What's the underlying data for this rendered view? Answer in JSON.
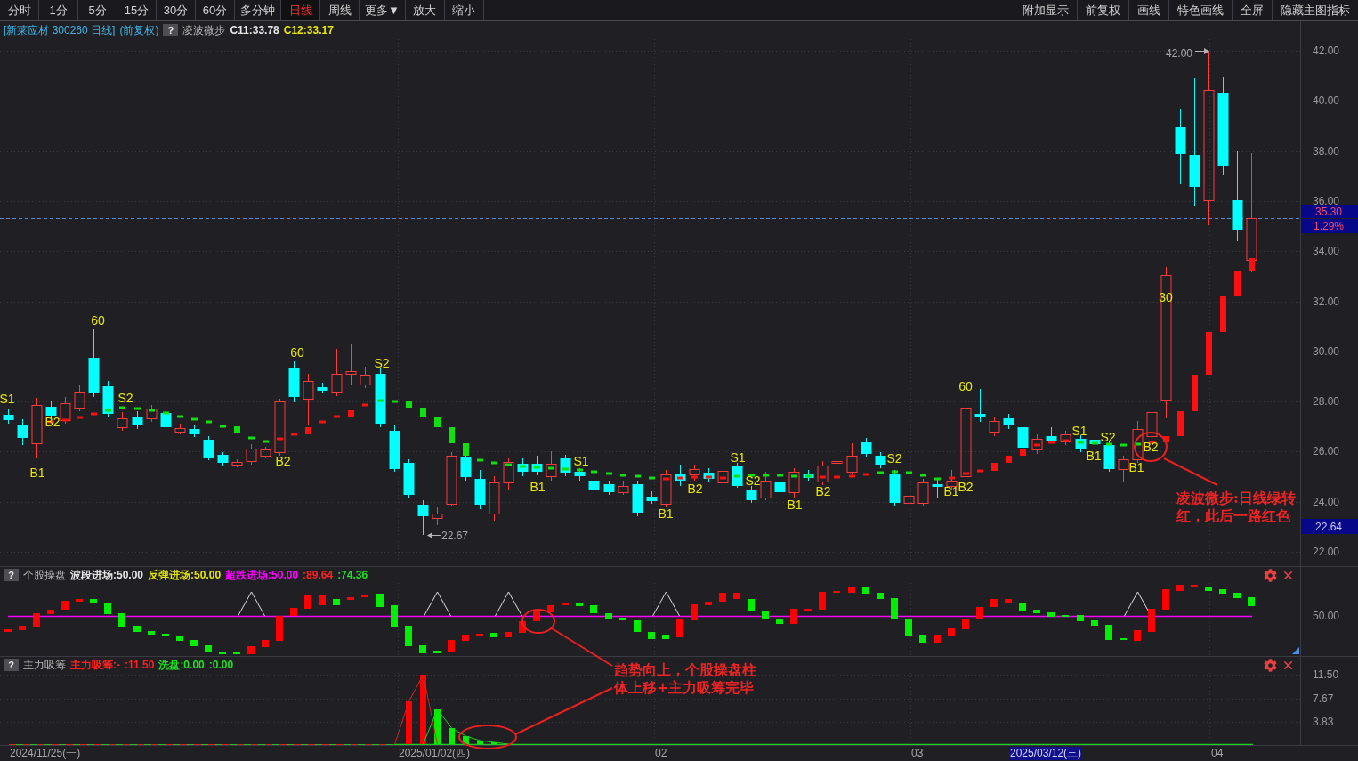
{
  "toolbar": {
    "periods": [
      {
        "label": "分时",
        "selected": false
      },
      {
        "label": "1分",
        "selected": false
      },
      {
        "label": "5分",
        "selected": false
      },
      {
        "label": "15分",
        "selected": false
      },
      {
        "label": "30分",
        "selected": false
      },
      {
        "label": "60分",
        "selected": false
      },
      {
        "label": "多分钟",
        "selected": false
      },
      {
        "label": "日线",
        "selected": true
      },
      {
        "label": "周线",
        "selected": false
      },
      {
        "label": "更多▼",
        "selected": false
      }
    ],
    "zoom": [
      "放大",
      "缩小"
    ],
    "actions": [
      "附加显示",
      "前复权",
      "画线",
      "特色画线",
      "全屏",
      "隐藏主图指标"
    ]
  },
  "main_chart": {
    "title": "[新莱应材 300260 日线]",
    "adjustment": "(前复权)",
    "help": "?",
    "indicator": "凌波微步",
    "readings": [
      {
        "text": "C11:33.78",
        "color": "#e6e6e6"
      },
      {
        "text": "C12:33.17",
        "color": "#e6e600"
      }
    ],
    "high_label": "42.00",
    "low_label": "22.67",
    "signals": [
      "S1",
      "B1",
      "B2",
      "60",
      "S2",
      "B2",
      "60",
      "S2",
      "B1",
      "S1",
      "B1",
      "B2",
      "S1",
      "S2",
      "B1",
      "B2",
      "S2",
      "B1",
      "60",
      "B2",
      "S1",
      "B1",
      "S2",
      "B1",
      "B2",
      "30"
    ],
    "y_ticks": [
      "42.00",
      "40.00",
      "38.00",
      "36.00",
      "34.00",
      "32.00",
      "30.00",
      "28.00",
      "26.00",
      "24.00",
      "22.00"
    ],
    "last_price": "35.30",
    "change": "1.29%",
    "low_tag": "22.64"
  },
  "panel_2": {
    "help": "?",
    "name": "个股操盘",
    "readings": [
      {
        "text": "波段进场:50.00",
        "color": "#e6e6e6"
      },
      {
        "text": "反弹进场:50.00",
        "color": "#e6e600"
      },
      {
        "text": "超跌进场:50.00",
        "color": "#ff00ff"
      },
      {
        "text": ":89.64",
        "color": "#ff2020"
      },
      {
        "text": ":74.36",
        "color": "#20e020"
      }
    ],
    "y_ticks": [
      "50.00"
    ]
  },
  "panel_3": {
    "help": "?",
    "name": "主力吸筹",
    "readings": [
      {
        "text": "主力吸筹:-",
        "color": "#ff2020"
      },
      {
        "text": ":11.50",
        "color": "#ff2020"
      },
      {
        "text": "洗盘:0.00",
        "color": "#20e020"
      },
      {
        "text": ":0.00",
        "color": "#20e020"
      }
    ],
    "y_ticks": [
      "11.50",
      "7.67",
      "3.83"
    ]
  },
  "annotations": [
    "凌波微步:日线绿转红，此后一路红色",
    "趋势向上，个股操盘柱体上移+主力吸筹完毕"
  ],
  "x_axis": [
    {
      "label": "2024/11/25(一)",
      "highlighted": false
    },
    {
      "label": "2025/01/02(四)",
      "highlighted": false
    },
    {
      "label": "02",
      "highlighted": false
    },
    {
      "label": "03",
      "highlighted": false
    },
    {
      "label": "2025/03/12(三)",
      "highlighted": true
    },
    {
      "label": "04",
      "highlighted": false
    }
  ]
}
